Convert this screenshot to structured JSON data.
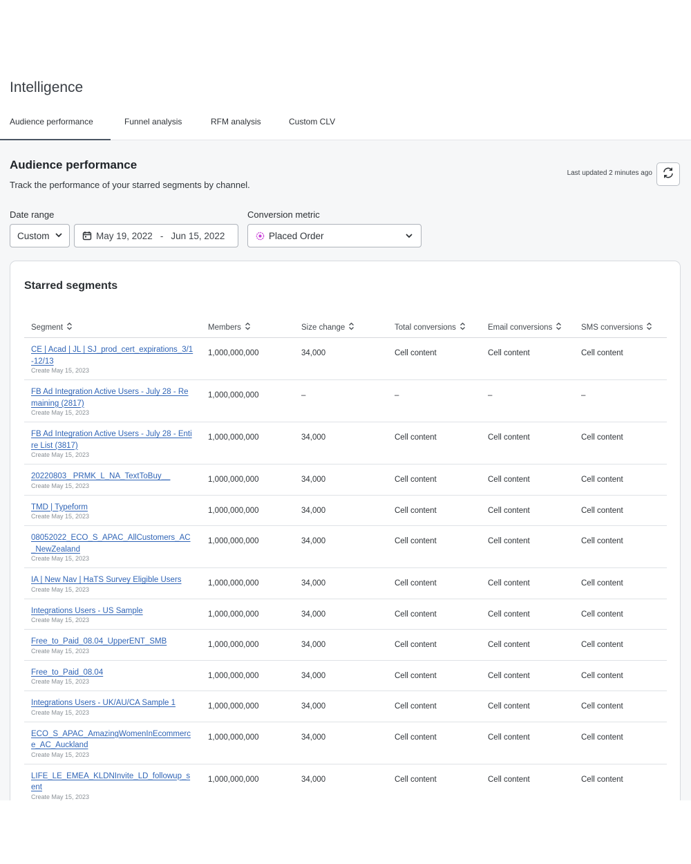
{
  "page": {
    "title": "Intelligence"
  },
  "tabs": [
    {
      "label": "Audience performance",
      "active": true
    },
    {
      "label": "Funnel analysis",
      "active": false
    },
    {
      "label": "RFM analysis",
      "active": false
    },
    {
      "label": "Custom CLV",
      "active": false
    }
  ],
  "section": {
    "title": "Audience performance",
    "description": "Track the performance of your starred segments by channel.",
    "last_updated": "Last updated 2 minutes ago"
  },
  "filters": {
    "date_range_label": "Date range",
    "date_range_mode": "Custom",
    "date_start": "May 19, 2022",
    "date_separator": "-",
    "date_end": "Jun 15, 2022",
    "conversion_metric_label": "Conversion metric",
    "conversion_metric_value": "Placed Order"
  },
  "card": {
    "title": "Starred segments"
  },
  "table": {
    "columns": [
      "Segment",
      "Members",
      "Size change",
      "Total conversions",
      "Email conversions",
      "SMS conversions"
    ],
    "rows": [
      {
        "segment": "CE | Acad | JL | SJ_prod_cert_expirations_3/1-12/13",
        "created": "Create May 15, 2023",
        "members": "1,000,000,000",
        "size_change": "34,000",
        "total": "Cell content",
        "email": "Cell content",
        "sms": "Cell content"
      },
      {
        "segment": "FB Ad Integration Active Users - July 28 - Remaining (2817)",
        "created": "Create May 15, 2023",
        "members": "1,000,000,000",
        "size_change": "–",
        "total": "–",
        "email": "–",
        "sms": "–"
      },
      {
        "segment": "FB Ad Integration Active Users - July 28 - Entire List (3817)",
        "created": "Create May 15, 2023",
        "members": "1,000,000,000",
        "size_change": "34,000",
        "total": "Cell content",
        "email": "Cell content",
        "sms": "Cell content"
      },
      {
        "segment": "20220803_ PRMK_L_NA_TextToBuy__",
        "created": "Create May 15, 2023",
        "members": "1,000,000,000",
        "size_change": "34,000",
        "total": "Cell content",
        "email": "Cell content",
        "sms": "Cell content"
      },
      {
        "segment": "TMD | Typeform",
        "created": "Create May 15, 2023",
        "members": "1,000,000,000",
        "size_change": "34,000",
        "total": "Cell content",
        "email": "Cell content",
        "sms": "Cell content"
      },
      {
        "segment": "08052022_ECO_S_APAC_AllCustomers_AC_NewZealand",
        "created": "Create May 15, 2023",
        "members": "1,000,000,000",
        "size_change": "34,000",
        "total": "Cell content",
        "email": "Cell content",
        "sms": "Cell content"
      },
      {
        "segment": "IA | New Nav | HaTS Survey Eligible Users",
        "created": "Create May 15, 2023",
        "members": "1,000,000,000",
        "size_change": "34,000",
        "total": "Cell content",
        "email": "Cell content",
        "sms": "Cell content"
      },
      {
        "segment": "Integrations Users - US Sample",
        "created": "Create May 15, 2023",
        "members": "1,000,000,000",
        "size_change": "34,000",
        "total": "Cell content",
        "email": "Cell content",
        "sms": "Cell content"
      },
      {
        "segment": "Free_to_Paid_08.04_UpperENT_SMB",
        "created": "Create May 15, 2023",
        "members": "1,000,000,000",
        "size_change": "34,000",
        "total": "Cell content",
        "email": "Cell content",
        "sms": "Cell content"
      },
      {
        "segment": "Free_to_Paid_08.04",
        "created": "Create May 15, 2023",
        "members": "1,000,000,000",
        "size_change": "34,000",
        "total": "Cell content",
        "email": "Cell content",
        "sms": "Cell content"
      },
      {
        "segment": "Integrations Users - UK/AU/CA Sample 1",
        "created": "Create May 15, 2023",
        "members": "1,000,000,000",
        "size_change": "34,000",
        "total": "Cell content",
        "email": "Cell content",
        "sms": "Cell content"
      },
      {
        "segment": "ECO_S_APAC_AmazingWomenInEcommerce_AC_Auckland",
        "created": "Create May 15, 2023",
        "members": "1,000,000,000",
        "size_change": "34,000",
        "total": "Cell content",
        "email": "Cell content",
        "sms": "Cell content"
      },
      {
        "segment": "LIFE_LE_EMEA_KLDNInvite_LD_followup_sent",
        "created": "Create May 15, 2023",
        "members": "1,000,000,000",
        "size_change": "34,000",
        "total": "Cell content",
        "email": "Cell content",
        "sms": "Cell content"
      }
    ]
  },
  "icons": {
    "refresh": "refresh-icon",
    "calendar": "calendar-icon",
    "chevron": "chevron-down-icon",
    "sort": "sort-icon",
    "metric": "placed-order-icon"
  },
  "colors": {
    "link": "#2f64b6",
    "metric_icon": "#c83fd8",
    "tab_indicator": "#4b5563"
  }
}
